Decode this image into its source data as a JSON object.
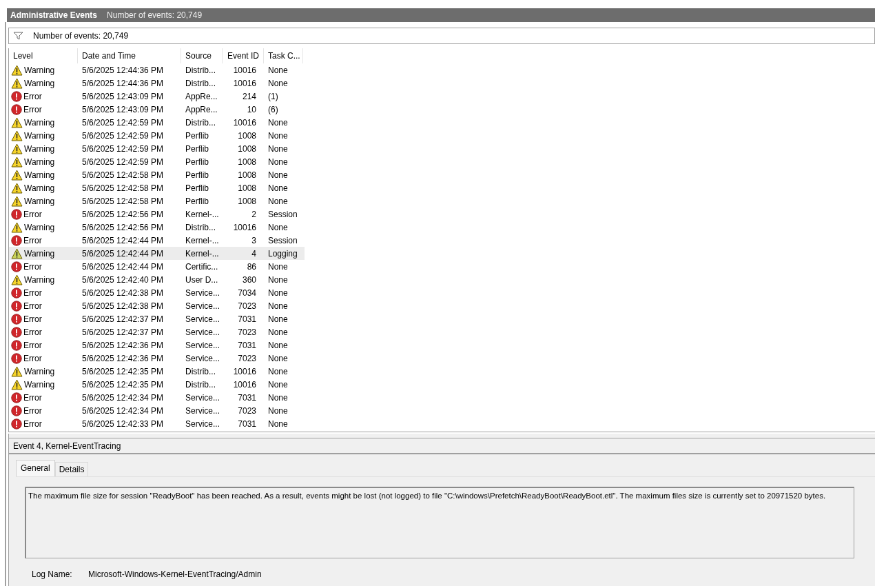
{
  "header": {
    "title": "Administrative Events",
    "count": "Number of events: 20,749"
  },
  "filter_bar": {
    "text": "Number of events: 20,749"
  },
  "table": {
    "columns": [
      "Level",
      "Date and Time",
      "Source",
      "Event ID",
      "Task C..."
    ],
    "rows": [
      {
        "level": "Warning",
        "kind": "warning",
        "date": "5/6/2025 12:44:36 PM",
        "source": "Distrib...",
        "event_id": "10016",
        "task": "None",
        "selected": false
      },
      {
        "level": "Warning",
        "kind": "warning",
        "date": "5/6/2025 12:44:36 PM",
        "source": "Distrib...",
        "event_id": "10016",
        "task": "None",
        "selected": false
      },
      {
        "level": "Error",
        "kind": "error",
        "date": "5/6/2025 12:43:09 PM",
        "source": "AppRe...",
        "event_id": "214",
        "task": "(1)",
        "selected": false
      },
      {
        "level": "Error",
        "kind": "error",
        "date": "5/6/2025 12:43:09 PM",
        "source": "AppRe...",
        "event_id": "10",
        "task": "(6)",
        "selected": false
      },
      {
        "level": "Warning",
        "kind": "warning",
        "date": "5/6/2025 12:42:59 PM",
        "source": "Distrib...",
        "event_id": "10016",
        "task": "None",
        "selected": false
      },
      {
        "level": "Warning",
        "kind": "warning",
        "date": "5/6/2025 12:42:59 PM",
        "source": "Perflib",
        "event_id": "1008",
        "task": "None",
        "selected": false
      },
      {
        "level": "Warning",
        "kind": "warning",
        "date": "5/6/2025 12:42:59 PM",
        "source": "Perflib",
        "event_id": "1008",
        "task": "None",
        "selected": false
      },
      {
        "level": "Warning",
        "kind": "warning",
        "date": "5/6/2025 12:42:59 PM",
        "source": "Perflib",
        "event_id": "1008",
        "task": "None",
        "selected": false
      },
      {
        "level": "Warning",
        "kind": "warning",
        "date": "5/6/2025 12:42:58 PM",
        "source": "Perflib",
        "event_id": "1008",
        "task": "None",
        "selected": false
      },
      {
        "level": "Warning",
        "kind": "warning",
        "date": "5/6/2025 12:42:58 PM",
        "source": "Perflib",
        "event_id": "1008",
        "task": "None",
        "selected": false
      },
      {
        "level": "Warning",
        "kind": "warning",
        "date": "5/6/2025 12:42:58 PM",
        "source": "Perflib",
        "event_id": "1008",
        "task": "None",
        "selected": false
      },
      {
        "level": "Error",
        "kind": "error",
        "date": "5/6/2025 12:42:56 PM",
        "source": "Kernel-...",
        "event_id": "2",
        "task": "Session",
        "selected": false
      },
      {
        "level": "Warning",
        "kind": "warning",
        "date": "5/6/2025 12:42:56 PM",
        "source": "Distrib...",
        "event_id": "10016",
        "task": "None",
        "selected": false
      },
      {
        "level": "Error",
        "kind": "error",
        "date": "5/6/2025 12:42:44 PM",
        "source": "Kernel-...",
        "event_id": "3",
        "task": "Session",
        "selected": false
      },
      {
        "level": "Warning",
        "kind": "warning",
        "date": "5/6/2025 12:42:44 PM",
        "source": "Kernel-...",
        "event_id": "4",
        "task": "Logging",
        "selected": true
      },
      {
        "level": "Error",
        "kind": "error",
        "date": "5/6/2025 12:42:44 PM",
        "source": "Certific...",
        "event_id": "86",
        "task": "None",
        "selected": false
      },
      {
        "level": "Warning",
        "kind": "warning",
        "date": "5/6/2025 12:42:40 PM",
        "source": "User D...",
        "event_id": "360",
        "task": "None",
        "selected": false
      },
      {
        "level": "Error",
        "kind": "error",
        "date": "5/6/2025 12:42:38 PM",
        "source": "Service...",
        "event_id": "7034",
        "task": "None",
        "selected": false
      },
      {
        "level": "Error",
        "kind": "error",
        "date": "5/6/2025 12:42:38 PM",
        "source": "Service...",
        "event_id": "7023",
        "task": "None",
        "selected": false
      },
      {
        "level": "Error",
        "kind": "error",
        "date": "5/6/2025 12:42:37 PM",
        "source": "Service...",
        "event_id": "7031",
        "task": "None",
        "selected": false
      },
      {
        "level": "Error",
        "kind": "error",
        "date": "5/6/2025 12:42:37 PM",
        "source": "Service...",
        "event_id": "7023",
        "task": "None",
        "selected": false
      },
      {
        "level": "Error",
        "kind": "error",
        "date": "5/6/2025 12:42:36 PM",
        "source": "Service...",
        "event_id": "7031",
        "task": "None",
        "selected": false
      },
      {
        "level": "Error",
        "kind": "error",
        "date": "5/6/2025 12:42:36 PM",
        "source": "Service...",
        "event_id": "7023",
        "task": "None",
        "selected": false
      },
      {
        "level": "Warning",
        "kind": "warning",
        "date": "5/6/2025 12:42:35 PM",
        "source": "Distrib...",
        "event_id": "10016",
        "task": "None",
        "selected": false
      },
      {
        "level": "Warning",
        "kind": "warning",
        "date": "5/6/2025 12:42:35 PM",
        "source": "Distrib...",
        "event_id": "10016",
        "task": "None",
        "selected": false
      },
      {
        "level": "Error",
        "kind": "error",
        "date": "5/6/2025 12:42:34 PM",
        "source": "Service...",
        "event_id": "7031",
        "task": "None",
        "selected": false
      },
      {
        "level": "Error",
        "kind": "error",
        "date": "5/6/2025 12:42:34 PM",
        "source": "Service...",
        "event_id": "7023",
        "task": "None",
        "selected": false
      },
      {
        "level": "Error",
        "kind": "error",
        "date": "5/6/2025 12:42:33 PM",
        "source": "Service...",
        "event_id": "7031",
        "task": "None",
        "selected": false
      }
    ]
  },
  "detail": {
    "title": "Event 4, Kernel-EventTracing",
    "tabs": [
      {
        "label": "General",
        "selected": true
      },
      {
        "label": "Details",
        "selected": false
      }
    ],
    "message": "The maximum file size for session \"ReadyBoot\" has been reached. As a result, events might be lost (not logged) to file \"C:\\windows\\Prefetch\\ReadyBoot\\ReadyBoot.etl\". The maximum files size is currently set to 20971520 bytes.",
    "fields": [
      {
        "label": "Log Name:",
        "value": "Microsoft-Windows-Kernel-EventTracing/Admin"
      }
    ]
  }
}
